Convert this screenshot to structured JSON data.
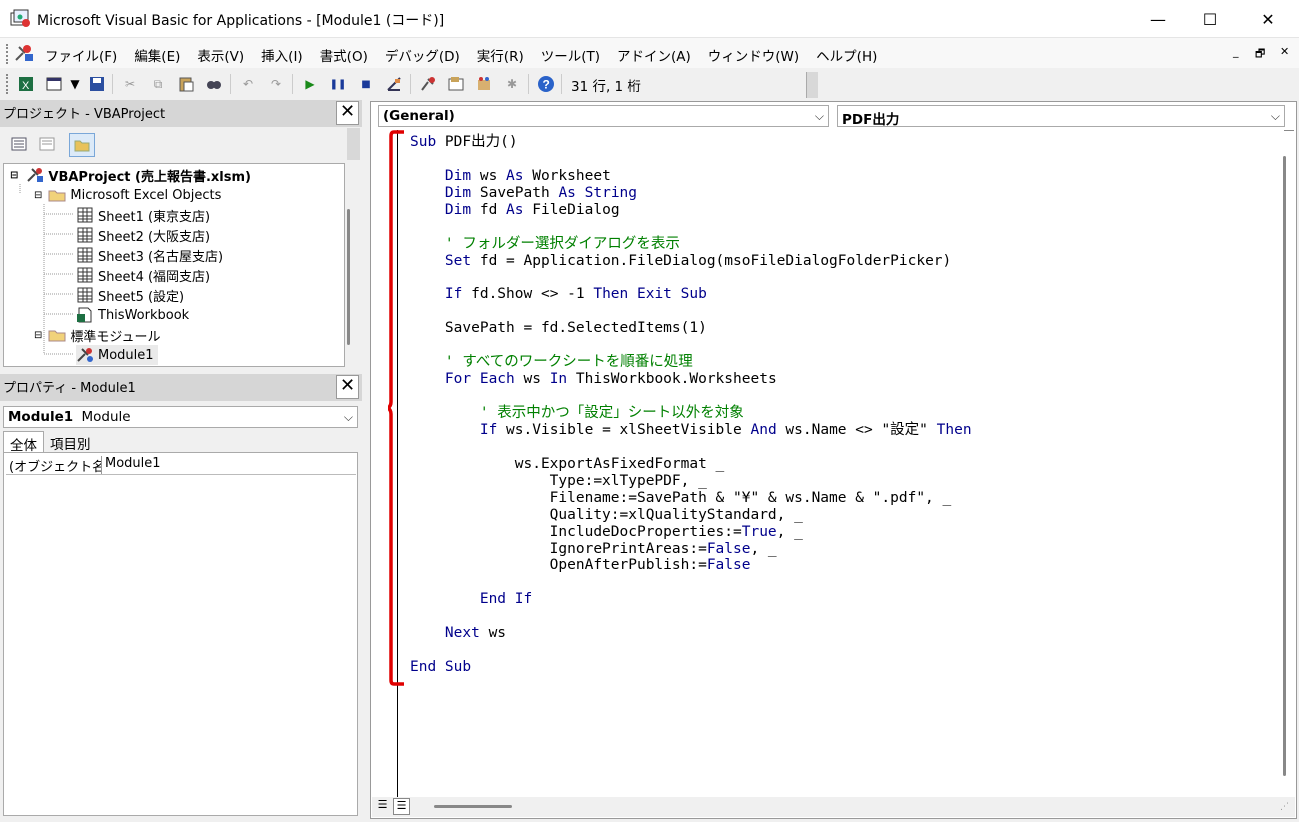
{
  "window": {
    "title": "Microsoft Visual Basic for Applications - [Module1 (コード)]",
    "minimize": "—",
    "maximize": "☐",
    "close": "✕"
  },
  "menu": {
    "items": [
      "ファイル(F)",
      "編集(E)",
      "表示(V)",
      "挿入(I)",
      "書式(O)",
      "デバッグ(D)",
      "実行(R)",
      "ツール(T)",
      "アドイン(A)",
      "ウィンドウ(W)",
      "ヘルプ(H)"
    ],
    "mdi_min": "_",
    "mdi_restore": "🗗",
    "mdi_close": "✕"
  },
  "toolbar": {
    "position": "31 行, 1 桁"
  },
  "project_panel": {
    "title": "プロジェクト - VBAProject",
    "close": "✕",
    "tree": {
      "root": "VBAProject (売上報告書.xlsm)",
      "excel_objects": "Microsoft Excel Objects",
      "sheets": [
        "Sheet1 (東京支店)",
        "Sheet2 (大阪支店)",
        "Sheet3 (名古屋支店)",
        "Sheet4 (福岡支店)",
        "Sheet5 (設定)",
        "ThisWorkbook"
      ],
      "modules_folder": "標準モジュール",
      "module": "Module1"
    }
  },
  "properties_panel": {
    "title": "プロパティ - Module1",
    "close": "✕",
    "object_name": "Module1",
    "object_type": "Module",
    "tabs": [
      "全体",
      "項目別"
    ],
    "prop_name": "(オブジェクト名)",
    "prop_value": "Module1"
  },
  "code_window": {
    "object_combo": "(General)",
    "proc_combo": "PDF出力"
  },
  "colors": {
    "keyword": "#00008b",
    "comment": "#008000",
    "bracket": "#e00000"
  }
}
